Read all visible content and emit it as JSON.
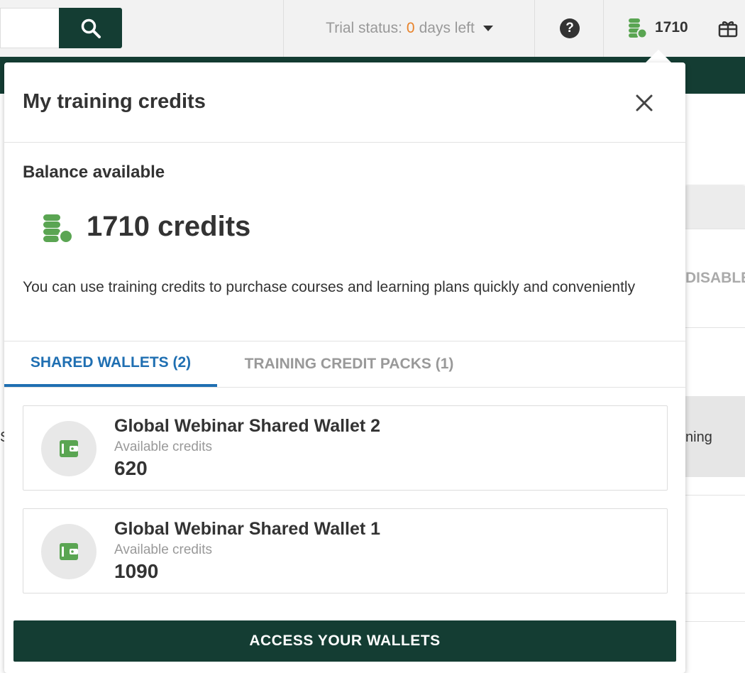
{
  "header": {
    "trial_prefix": "Trial status:",
    "trial_days": "0",
    "trial_suffix": "days left",
    "help_label": "?",
    "credits_count": "1710"
  },
  "background": {
    "disable_text": "DISABLE",
    "row_text": "ning",
    "left_char": "S"
  },
  "popup": {
    "title": "My training credits",
    "balance_label": "Balance available",
    "balance_value": "1710 credits",
    "description": "You can use training credits to purchase courses and learning plans quickly and conveniently",
    "tabs": [
      {
        "label": "SHARED WALLETS (2)",
        "active": true
      },
      {
        "label": "TRAINING CREDIT PACKS (1)",
        "active": false
      }
    ],
    "wallets": [
      {
        "name": "Global Webinar Shared Wallet 2",
        "sub": "Available credits",
        "value": "620"
      },
      {
        "name": "Global Webinar Shared Wallet 1",
        "sub": "Available credits",
        "value": "1090"
      }
    ],
    "access_button": "ACCESS YOUR WALLETS"
  },
  "icons": {
    "search": "search-icon",
    "caret": "caret-down-icon",
    "help": "help-icon",
    "coins": "coins-icon",
    "gift": "gift-icon",
    "close": "close-icon",
    "wallet": "wallet-icon"
  },
  "colors": {
    "brand_dark": "#143d33",
    "coin_green": "#5aa552",
    "tab_active": "#1f6fb2",
    "trial_highlight": "#e8822a"
  }
}
